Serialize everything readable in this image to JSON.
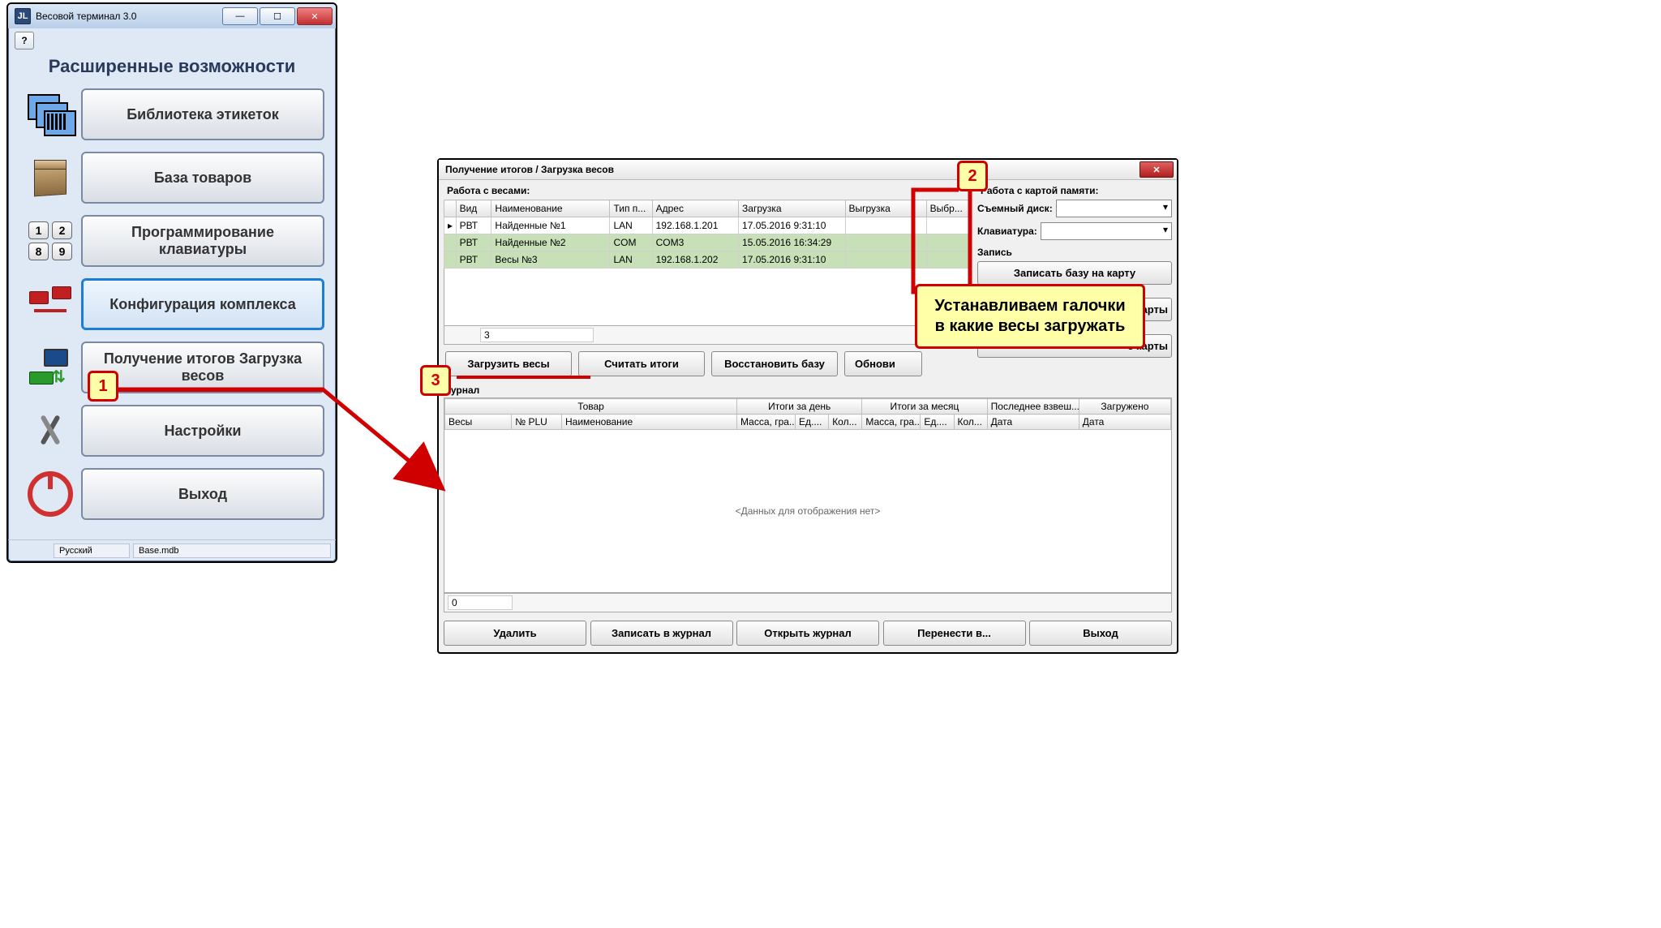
{
  "main": {
    "title": "Весовой терминал 3.0",
    "help": "?",
    "heading": "Расширенные возможности",
    "buttons": {
      "labels": "Библиотека этикеток",
      "goods": "База товаров",
      "keyboard": "Программирование клавиатуры",
      "config": "Конфигурация комплекса",
      "totals": "Получение итогов Загрузка весов",
      "settings": "Настройки",
      "exit": "Выход"
    },
    "keys": [
      "1",
      "2",
      "8",
      "9"
    ],
    "footer": {
      "lang": "Русский",
      "db": "Base.mdb"
    }
  },
  "dlg": {
    "title": "Получение итогов / Загрузка весов",
    "scales_label": "Работа с весами:",
    "cols": {
      "vid": "Вид",
      "name": "Наименование",
      "type": "Тип п...",
      "addr": "Адрес",
      "load": "Загрузка",
      "unload": "Выгрузка",
      "sel": "Выбр..."
    },
    "rows": [
      {
        "vid": "РВТ",
        "name": "Найденные №1",
        "type": "LAN",
        "addr": "192.168.1.201",
        "load": "17.05.2016 9:31:10",
        "unload": ""
      },
      {
        "vid": "РВТ",
        "name": "Найденные №2",
        "type": "COM",
        "addr": "COM3",
        "load": "15.05.2016 16:34:29",
        "unload": ""
      },
      {
        "vid": "РВТ",
        "name": "Весы №3",
        "type": "LAN",
        "addr": "192.168.1.202",
        "load": "17.05.2016 9:31:10",
        "unload": ""
      }
    ],
    "row_count": "3",
    "actions": {
      "load": "Загрузить весы",
      "read": "Считать итоги",
      "restore": "Восстановить базу",
      "refresh": "Обнови"
    },
    "mem": {
      "label": "Работа с картой памяти:",
      "disk": "Съемный диск:",
      "kbd": "Клавиатура:",
      "write": "Запись",
      "write_btn": "Записать базу на карту",
      "card2": "карты",
      "card3": "с карты"
    },
    "journal": {
      "label": "Журнал",
      "group_tovar": "Товар",
      "group_day": "Итоги за день",
      "group_month": "Итоги за месяц",
      "group_last": "Последнее взвеш...",
      "group_loaded": "Загружено",
      "c_vesy": "Весы",
      "c_plu": "№ PLU",
      "c_name": "Наименование",
      "c_mass": "Масса, гра...",
      "c_ed": "Ед....",
      "c_kol": "Кол...",
      "c_date": "Дата",
      "empty": "<Данных для отображения нет>",
      "count": "0"
    },
    "bottom": {
      "del": "Удалить",
      "save": "Записать в журнал",
      "open": "Открыть журнал",
      "move": "Перенести в...",
      "exit": "Выход"
    }
  },
  "anno": {
    "n1": "1",
    "n2": "2",
    "n3": "3",
    "tip": "Устанавливаем галочки в какие весы загружать"
  }
}
